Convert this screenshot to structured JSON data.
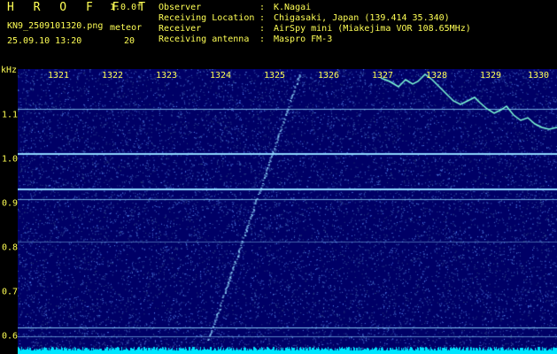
{
  "header": {
    "app_title": "H R O F F T",
    "version": "1.0.0f",
    "filename": "KN9_2509101320.png",
    "datetime": "25.09.10 13:20",
    "mode_label": "meteor",
    "mode_value": "20",
    "info": [
      {
        "key": "Observer",
        "value": "K.Nagai"
      },
      {
        "key": "Receiving Location",
        "value": "Chigasaki, Japan (139.414 35.340)"
      },
      {
        "key": "Receiver",
        "value": "AirSpy mini (Miakejima VOR 108.65MHz)"
      },
      {
        "key": "Receiving antenna",
        "value": "Maspro FM-3"
      }
    ]
  },
  "spectrogram": {
    "y_unit": "kHz",
    "x_ticks": [
      "1321",
      "1322",
      "1323",
      "1324",
      "1325",
      "1326",
      "1327",
      "1328",
      "1329",
      "1330"
    ],
    "y_ticks": [
      "1.1",
      "1.0",
      "0.9",
      "0.8",
      "0.7",
      "0.6"
    ],
    "background_color": "#000066",
    "line_color": "#8fd8ff",
    "trace_color": "#7fffd8",
    "baseline_color": "#00e6ff"
  }
}
